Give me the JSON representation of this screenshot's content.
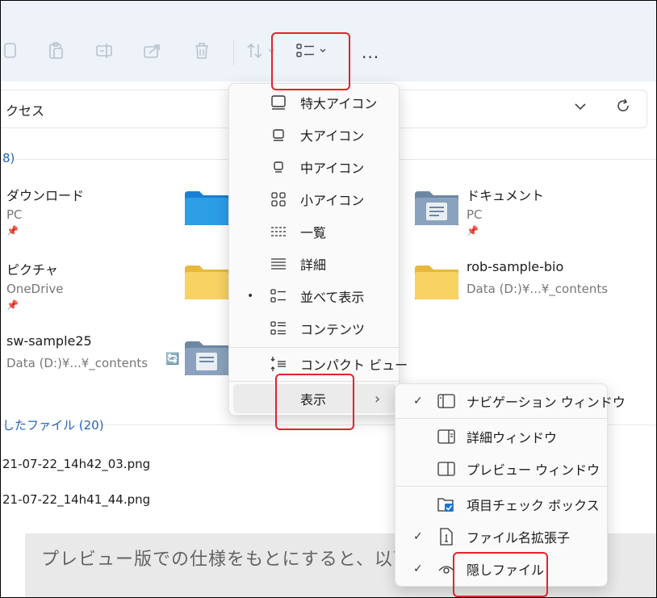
{
  "toolbar": {
    "icons": [
      "copy-icon",
      "paste-icon",
      "rename-icon",
      "share-icon",
      "delete-icon",
      "sort-icon",
      "view-icon",
      "chevron-down-icon",
      "more-icon"
    ],
    "more_label": "..."
  },
  "address": {
    "text": "クセス"
  },
  "sections": {
    "quick_access_count": "8)",
    "recent_files": "したファイル (20)"
  },
  "tiles": [
    {
      "name": "ダウンロード",
      "sub": "PC"
    },
    {
      "name": "ドキュメント",
      "sub": "PC"
    },
    {
      "name": "ピクチャ",
      "sub": "OneDrive"
    },
    {
      "name": "rob-sample-bio",
      "sub": "Data (D:)¥...¥_contents"
    },
    {
      "name": "sw-sample25",
      "sub": "Data (D:)¥...¥_contents"
    }
  ],
  "files": [
    "21-07-22_14h42_03.png",
    "21-07-22_14h41_44.png"
  ],
  "view_menu": {
    "items": [
      {
        "label": "特大アイコン",
        "icon": "extra-large-icons-icon"
      },
      {
        "label": "大アイコン",
        "icon": "large-icons-icon"
      },
      {
        "label": "中アイコン",
        "icon": "medium-icons-icon"
      },
      {
        "label": "小アイコン",
        "icon": "small-icons-icon"
      },
      {
        "label": "一覧",
        "icon": "list-icon"
      },
      {
        "label": "詳細",
        "icon": "details-icon"
      },
      {
        "label": "並べて表示",
        "icon": "tiles-icon",
        "selected": true
      },
      {
        "label": "コンテンツ",
        "icon": "content-icon"
      }
    ],
    "compact": "コンパクト ビュー",
    "show": "表示",
    "bullet": "•",
    "arrow": "›"
  },
  "show_submenu": {
    "items": [
      {
        "label": "ナビゲーション ウィンドウ",
        "checked": true,
        "icon": "navigation-pane-icon"
      },
      {
        "label": "詳細ウィンドウ",
        "checked": false,
        "icon": "details-pane-icon"
      },
      {
        "label": "プレビュー ウィンドウ",
        "checked": false,
        "icon": "preview-pane-icon"
      },
      {
        "label": "項目チェック ボックス",
        "checked": false,
        "icon": "checkbox-icon"
      },
      {
        "label": "ファイル名拡張子",
        "checked": true,
        "icon": "file-extension-icon"
      },
      {
        "label": "隠しファイル",
        "checked": true,
        "icon": "hidden-eye-icon"
      }
    ],
    "check": "✓"
  },
  "background_doc": {
    "text": "プレビュー版での仕様をもとにすると、以下"
  },
  "colors": {
    "highlight": "#e0242a",
    "accent": "#2563b6"
  }
}
